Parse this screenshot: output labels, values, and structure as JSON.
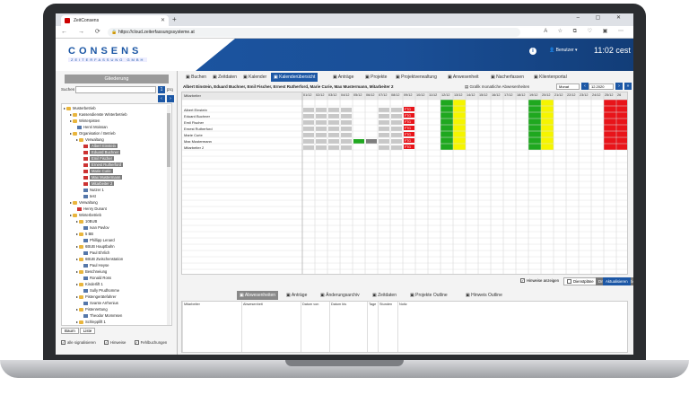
{
  "browser": {
    "tab_title": "ZeitConsens",
    "new_tab": "+",
    "window_controls": "– ▢ ✕",
    "nav_buttons": "← → ⟳",
    "url": "https://cloud.zeiterfassungssysteme.at",
    "tool_icons": "A ☆ ⧉ ♡ ▣ ⋯"
  },
  "header": {
    "logo": "CONSENS",
    "logo_sub": "ZEITERFASSUNG GMBH",
    "user": "Benutzer",
    "clock": "11:02 cest"
  },
  "left": {
    "title": "Gliederung",
    "search_label": "Suchen",
    "search_value": "",
    "page_value": "1",
    "page_total": "[21]",
    "tree": [
      {
        "label": "Musterbetrieb",
        "indent": 0,
        "icon": "folder",
        "sel": false
      },
      {
        "label": "Kassendienste Winterbetrieb",
        "indent": 1,
        "icon": "folder",
        "sel": false
      },
      {
        "label": "Winterpisten",
        "indent": 1,
        "icon": "folder",
        "sel": false
      },
      {
        "label": "Henri Moissan",
        "indent": 2,
        "icon": "person",
        "sel": false
      },
      {
        "label": "Organisation / Betrieb",
        "indent": 1,
        "icon": "folder",
        "sel": false
      },
      {
        "label": "Verwaltung",
        "indent": 2,
        "icon": "folder",
        "sel": false
      },
      {
        "label": "Albert Einstein",
        "indent": 3,
        "icon": "person-r",
        "sel": true
      },
      {
        "label": "Eduard Buchner",
        "indent": 3,
        "icon": "person-r",
        "sel": true
      },
      {
        "label": "Emil Fischer",
        "indent": 3,
        "icon": "person-r",
        "sel": true
      },
      {
        "label": "Ernest Rutherford",
        "indent": 3,
        "icon": "person-r",
        "sel": true
      },
      {
        "label": "Marie Curie",
        "indent": 3,
        "icon": "person-r",
        "sel": true
      },
      {
        "label": "Max Mustermann",
        "indent": 3,
        "icon": "person-r",
        "sel": true
      },
      {
        "label": "Mitarbeiter 2",
        "indent": 3,
        "icon": "person-r",
        "sel": true
      },
      {
        "label": "Nutzer 1",
        "indent": 3,
        "icon": "person",
        "sel": false
      },
      {
        "label": "test",
        "indent": 3,
        "icon": "person",
        "sel": false
      },
      {
        "label": "Verwaltung",
        "indent": 1,
        "icon": "folder",
        "sel": false
      },
      {
        "label": "Henry Dunant",
        "indent": 2,
        "icon": "person-r",
        "sel": false
      },
      {
        "label": "Winterbetrieb",
        "indent": 1,
        "icon": "folder",
        "sel": false
      },
      {
        "label": "10BUB",
        "indent": 2,
        "icon": "folder",
        "sel": false
      },
      {
        "label": "Ivan Pavlov",
        "indent": 3,
        "icon": "person",
        "sel": false
      },
      {
        "label": "5 BB",
        "indent": 2,
        "icon": "folder",
        "sel": false
      },
      {
        "label": "Phillipp Lenard",
        "indent": 3,
        "icon": "person",
        "sel": false
      },
      {
        "label": "6BUB Hauptbahn",
        "indent": 2,
        "icon": "folder",
        "sel": false
      },
      {
        "label": "Paul Ehrlich",
        "indent": 3,
        "icon": "person",
        "sel": false
      },
      {
        "label": "6BUB Zwischenstation",
        "indent": 2,
        "icon": "folder",
        "sel": false
      },
      {
        "label": "Paul Heyse",
        "indent": 3,
        "icon": "person",
        "sel": false
      },
      {
        "label": "Beschneiung",
        "indent": 2,
        "icon": "folder",
        "sel": false
      },
      {
        "label": "Ronald Ross",
        "indent": 3,
        "icon": "person",
        "sel": false
      },
      {
        "label": "Kinderlift 1",
        "indent": 2,
        "icon": "folder",
        "sel": false
      },
      {
        "label": "Sully Prudhomme",
        "indent": 3,
        "icon": "person",
        "sel": false
      },
      {
        "label": "Pistengerätefahrer",
        "indent": 2,
        "icon": "folder",
        "sel": false
      },
      {
        "label": "Svante Arrhenius",
        "indent": 3,
        "icon": "person",
        "sel": false
      },
      {
        "label": "Pistenrettung",
        "indent": 2,
        "icon": "folder",
        "sel": false
      },
      {
        "label": "Theodor Mommsen",
        "indent": 3,
        "icon": "person",
        "sel": false
      },
      {
        "label": "Schlepplift 1",
        "indent": 2,
        "icon": "folder",
        "sel": false
      }
    ],
    "bottom_tabs": [
      "Baum",
      "Liste"
    ],
    "checks": [
      {
        "label": "alle signalisieren",
        "checked": true
      },
      {
        "label": "Hinweise",
        "checked": true
      },
      {
        "label": "Fehlbuchungen",
        "checked": true
      }
    ]
  },
  "tabs": [
    "Buchen",
    "Zeitdaten",
    "Kalender",
    "Kalenderübersicht",
    "Anträge",
    "Projekte",
    "Projektverwaltung",
    "Anwesenheit",
    "Nacherfassen",
    "Klientenportal"
  ],
  "active_tab": "Kalenderübersicht",
  "subhead": {
    "names": "Albert Einstein, Eduard Buchner, Emil Fischer, Ernest Rutherford, Marie Curie, Max Mustermann, Mitarbeiter 2",
    "grafik": "Grafik monatliche Abwesenheiten",
    "period": "Monat",
    "date": "12.2020"
  },
  "calendar": {
    "col_header": "Mitarbeiter",
    "days": [
      "01/12",
      "02/12",
      "03/12",
      "04/12",
      "05/12",
      "06/12",
      "07/12",
      "08/12",
      "09/12",
      "10/12",
      "11/12",
      "12/12",
      "13/12",
      "14/12",
      "15/12",
      "16/12",
      "17/12",
      "18/12",
      "19/12",
      "20/12",
      "21/12",
      "22/12",
      "23/12",
      "24/12",
      "25/12",
      "26"
    ],
    "employees": [
      "Albert Einstein",
      "Eduard Buchner",
      "Emil Fischer",
      "Ernest Rutherford",
      "Marie Curie",
      "Max Mustermann",
      "Mitarbeiter 2"
    ],
    "holiday_label": "FTG",
    "colors": {
      "green": "#1fa81f",
      "yellow": "#f5f500",
      "red": "#e8141a",
      "gray": "#c8c8c8",
      "accent": "#1c57a5"
    }
  },
  "controls": {
    "hinweise": "Hinweise anzeigen",
    "dienstplaene": "Dienstpläne",
    "drucken": "Drucken",
    "exportieren": "Exportieren",
    "aktualisieren": "Aktualisieren"
  },
  "bottom_tabs": [
    "Abwesenheiten",
    "Anträge",
    "Änderungsarchiv",
    "Zeitdaten",
    "Projekte Outline",
    "Hinweis Outline"
  ],
  "bottom_active": "Abwesenheiten",
  "bottom_columns": [
    "Mitarbeiter",
    "Abwesenheit",
    "Datum von",
    "Datum bis",
    "Tage",
    "Stunden",
    "Notiz"
  ]
}
